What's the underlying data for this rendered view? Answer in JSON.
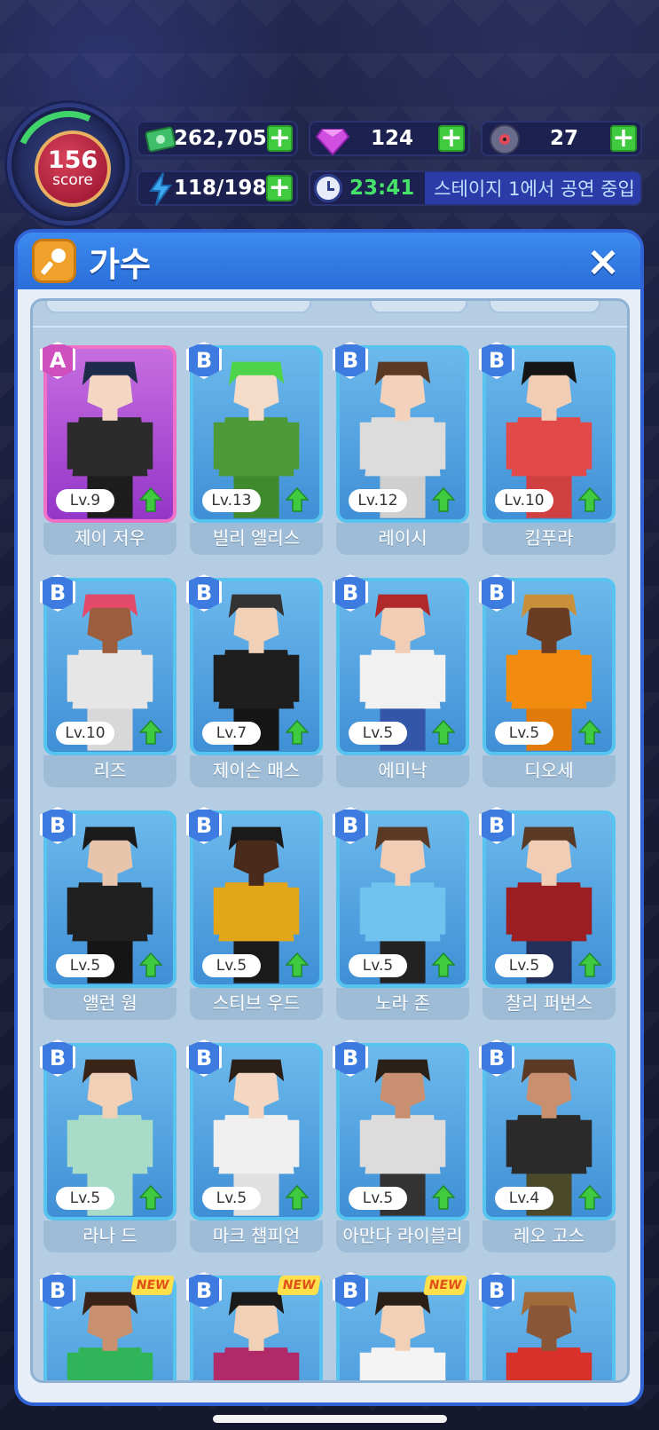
{
  "hud": {
    "score_value": "156",
    "score_label": "score",
    "cash": "262,705",
    "gems": "124",
    "records": "27",
    "energy": "118/198",
    "timer": "23:41",
    "status_msg": "스테이지 1에서 공연 중입"
  },
  "panel": {
    "title": "가수",
    "close_label": "×"
  },
  "colors": {
    "panel_blue": "#2f63d6",
    "card_blue": "#57c4ef",
    "rank_a": "#f070c8",
    "upgrade_green": "#3fca3f",
    "timer_green": "#47e26a"
  },
  "singers": [
    {
      "rank": "A",
      "level": "Lv.9",
      "name": "제이 저우",
      "skin": "#f3d7c2",
      "hair": "#1e2b4a",
      "top": "#2b2b2b",
      "bottom": "#1d1d1d"
    },
    {
      "rank": "B",
      "level": "Lv.13",
      "name": "빌리 엘리스",
      "skin": "#f5dcc8",
      "hair": "#4ed44a",
      "top": "#4f9a38",
      "bottom": "#3f8a2c"
    },
    {
      "rank": "B",
      "level": "Lv.12",
      "name": "레이시",
      "skin": "#f3d2bc",
      "hair": "#5a3a25",
      "top": "#dcdcdc",
      "bottom": "#cfcfcf"
    },
    {
      "rank": "B",
      "level": "Lv.10",
      "name": "킴푸라",
      "skin": "#f1cdb5",
      "hair": "#151515",
      "top": "#e24a4a",
      "bottom": "#d04040"
    },
    {
      "rank": "B",
      "level": "Lv.10",
      "name": "리즈",
      "skin": "#9b5d3e",
      "hair": "#e34a6a",
      "top": "#e6e6e6",
      "bottom": "#d8d8d8"
    },
    {
      "rank": "B",
      "level": "Lv.7",
      "name": "제이슨 매스",
      "skin": "#f1d0b8",
      "hair": "#333333",
      "top": "#1e1e1e",
      "bottom": "#161616"
    },
    {
      "rank": "B",
      "level": "Lv.5",
      "name": "에미낙",
      "skin": "#f1cdb5",
      "hair": "#b02a2a",
      "top": "#f1f1f1",
      "bottom": "#3456a8"
    },
    {
      "rank": "B",
      "level": "Lv.5",
      "name": "디오세",
      "skin": "#6a3c24",
      "hair": "#c8903a",
      "top": "#f28c10",
      "bottom": "#e07a08"
    },
    {
      "rank": "B",
      "level": "Lv.5",
      "name": "앨런 웜",
      "skin": "#e7c4ac",
      "hair": "#1a1a1a",
      "top": "#202020",
      "bottom": "#151515"
    },
    {
      "rank": "B",
      "level": "Lv.5",
      "name": "스티브 우드",
      "skin": "#4a2a1a",
      "hair": "#1a1a1a",
      "top": "#e3a51a",
      "bottom": "#1a1a1a"
    },
    {
      "rank": "B",
      "level": "Lv.5",
      "name": "노라 존",
      "skin": "#f1cdb5",
      "hair": "#5a3a25",
      "top": "#6fc3ee",
      "bottom": "#222222"
    },
    {
      "rank": "B",
      "level": "Lv.5",
      "name": "찰리 퍼번스",
      "skin": "#f1cdb5",
      "hair": "#5a3a25",
      "top": "#9a1e22",
      "bottom": "#23305a"
    },
    {
      "rank": "B",
      "level": "Lv.5",
      "name": "라나 드",
      "skin": "#f1d0b8",
      "hair": "#3a2418",
      "top": "#a8dcc8",
      "bottom": "#a8dcc8"
    },
    {
      "rank": "B",
      "level": "Lv.5",
      "name": "마크 챔피언",
      "skin": "#f3d7c2",
      "hair": "#2a2018",
      "top": "#f0f0f0",
      "bottom": "#e0e0e0"
    },
    {
      "rank": "B",
      "level": "Lv.5",
      "name": "아만다 라이블리",
      "skin": "#c89070",
      "hair": "#2a2018",
      "top": "#dcdcdc",
      "bottom": "#333333"
    },
    {
      "rank": "B",
      "level": "Lv.4",
      "name": "레오 고스",
      "skin": "#c8906e",
      "hair": "#5a3a25",
      "top": "#2a2a2a",
      "bottom": "#4a4a2a"
    },
    {
      "rank": "B",
      "new": "NEW",
      "skin": "#c8906e",
      "hair": "#3a2418",
      "top": "#2fb45a",
      "bottom": "#2fb45a"
    },
    {
      "rank": "B",
      "new": "NEW",
      "skin": "#f1d0b8",
      "hair": "#1a1a1a",
      "top": "#b02a6a",
      "bottom": "#b02a6a"
    },
    {
      "rank": "B",
      "new": "NEW",
      "skin": "#f1d0b8",
      "hair": "#2a2018",
      "top": "#f4f4f4",
      "bottom": "#f4f4f4"
    },
    {
      "rank": "B",
      "skin": "#8a5638",
      "hair": "#a06a3a",
      "top": "#d8302a",
      "bottom": "#d8302a"
    }
  ]
}
